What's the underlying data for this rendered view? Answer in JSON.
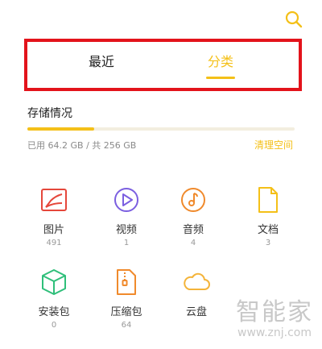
{
  "header": {
    "search_icon": "search-icon",
    "tabs": [
      {
        "label": "最近",
        "active": false
      },
      {
        "label": "分类",
        "active": true
      }
    ],
    "accent_color": "#f4c018",
    "highlight_color": "#e3131b"
  },
  "storage": {
    "title": "存储情况",
    "used": "已用 64.2 GB",
    "separator": "/",
    "total": "共 256 GB",
    "clean_label": "清理空间",
    "used_fraction": 0.25
  },
  "categories": [
    {
      "icon": "image-icon",
      "label": "图片",
      "count": "491",
      "color": "#e5473b"
    },
    {
      "icon": "video-icon",
      "label": "视频",
      "count": "1",
      "color": "#7b5fe0"
    },
    {
      "icon": "music-icon",
      "label": "音频",
      "count": "4",
      "color": "#f08a2c"
    },
    {
      "icon": "document-icon",
      "label": "文档",
      "count": "3",
      "color": "#f4c018"
    },
    {
      "icon": "package-icon",
      "label": "安装包",
      "count": "0",
      "color": "#2fbf7a"
    },
    {
      "icon": "zip-icon",
      "label": "压缩包",
      "count": "64",
      "color": "#f08a2c"
    },
    {
      "icon": "cloud-icon",
      "label": "云盘",
      "count": "",
      "color": "#f4b43a"
    }
  ],
  "watermark": {
    "text": "智能家",
    "url": "www.znj.com"
  }
}
